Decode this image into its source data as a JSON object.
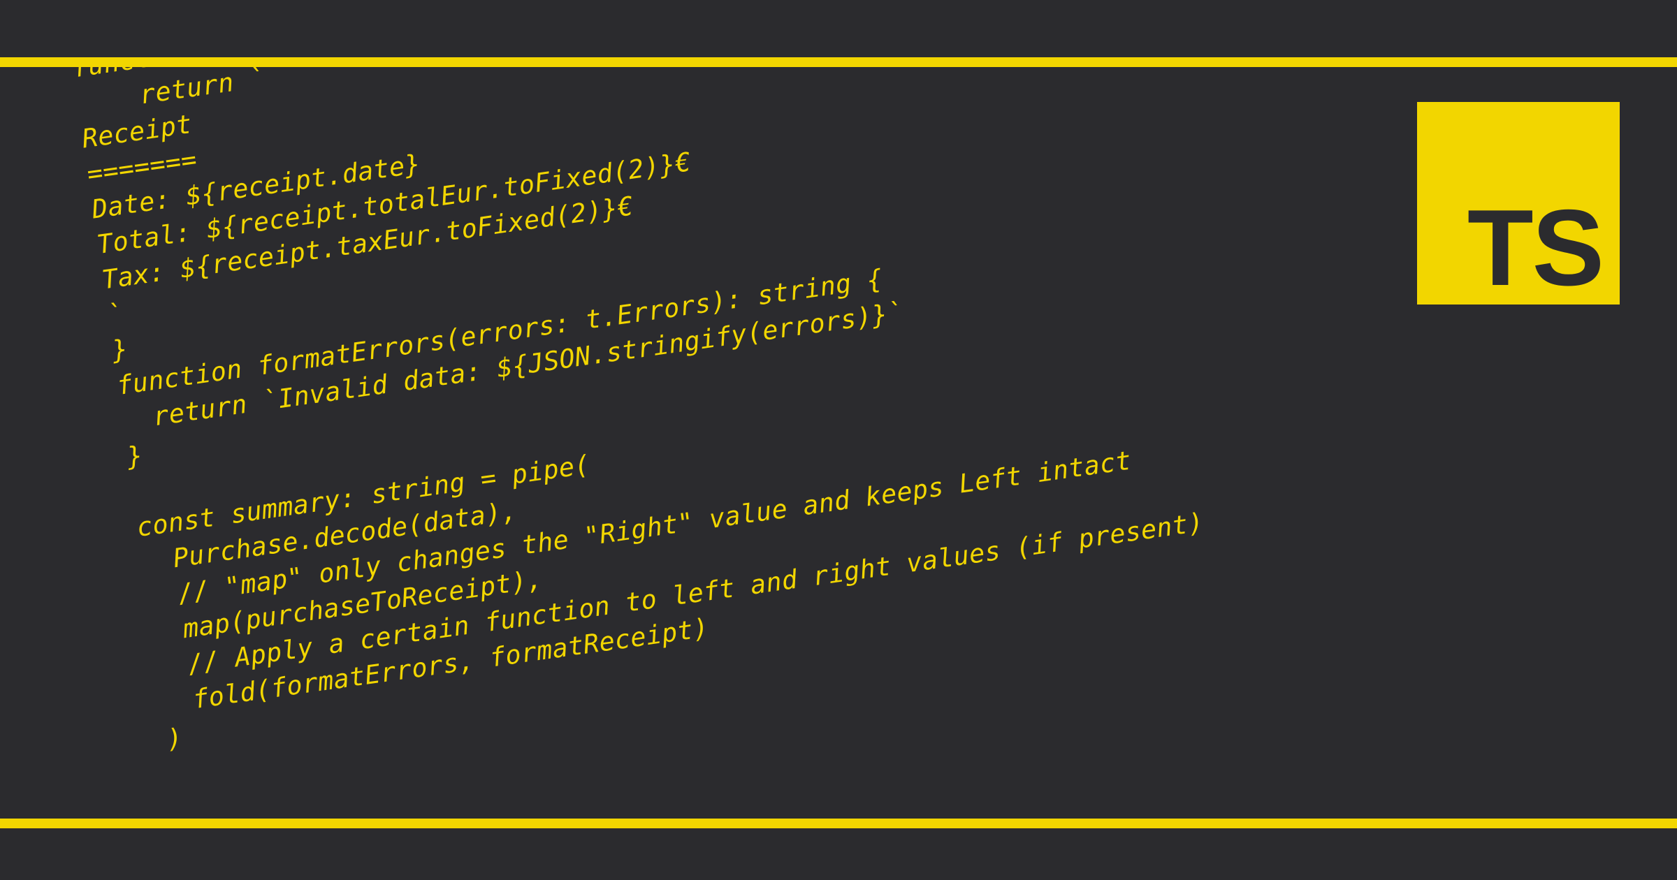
{
  "badge": {
    "label": "TS"
  },
  "code": {
    "lines": [
      "function formatReceipt(receipt: Receipt): string {",
      "    return `",
      "Receipt",
      "=======",
      "Date: ${receipt.date}",
      "Total: ${receipt.totalEur.toFixed(2)}€",
      "Tax: ${receipt.taxEur.toFixed(2)}€",
      "`",
      "}",
      "function formatErrors(errors: t.Errors): string {",
      "  return `Invalid data: ${JSON.stringify(errors)}`",
      "}",
      "",
      "const summary: string = pipe(",
      "  Purchase.decode(data),",
      "  // \"map\" only changes the \"Right\" value and keeps Left intact",
      "  map(purchaseToReceipt),",
      "  // Apply a certain function to left and right values (if present)",
      "  fold(formatErrors, formatReceipt)",
      ")"
    ]
  }
}
